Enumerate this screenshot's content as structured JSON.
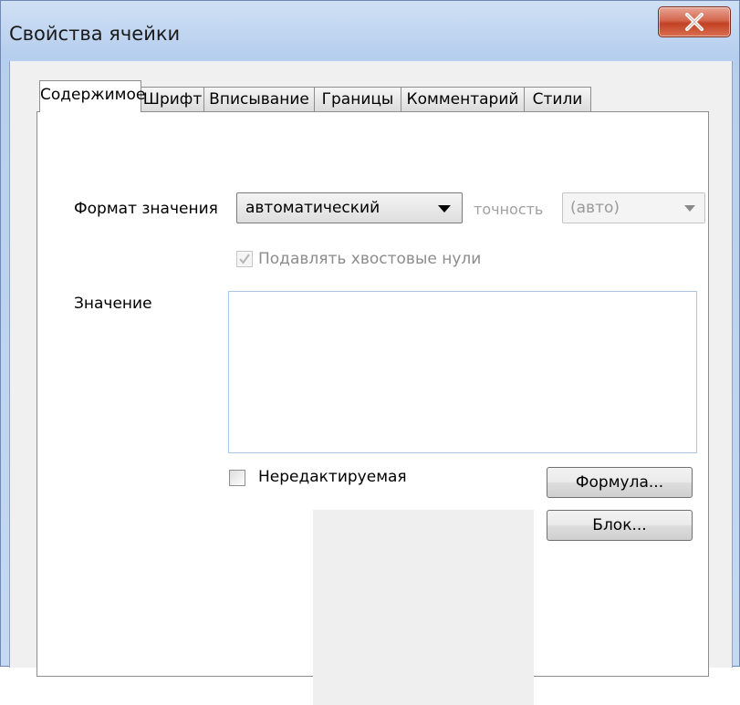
{
  "window": {
    "title": "Свойства ячейки"
  },
  "tabs": [
    {
      "label": "Содержимое",
      "active": true
    },
    {
      "label": "Шрифт"
    },
    {
      "label": "Вписывание"
    },
    {
      "label": "Границы"
    },
    {
      "label": "Комментарий"
    },
    {
      "label": "Стили"
    }
  ],
  "content": {
    "format_label": "Формат значения",
    "format_value": "автоматический",
    "precision_label": "точность",
    "precision_value": "(авто)",
    "suppress_zeros_label": "Подавлять хвостовые нули",
    "suppress_zeros_checked": true,
    "value_label": "Значение",
    "value_text": "",
    "readonly_label": "Нередактируемая",
    "readonly_checked": false,
    "formula_button": "Формула...",
    "block_button": "Блок..."
  },
  "icons": {
    "close": "close-icon",
    "dropdown": "chevron-down-icon",
    "check": "checkmark-icon"
  }
}
